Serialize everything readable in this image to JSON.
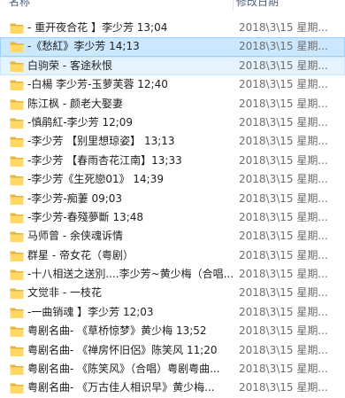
{
  "header": {
    "name_label": "名称",
    "date_label": "修改日期"
  },
  "rows": [
    {
      "name": "- 重开夜合花 】李少芳 13;04",
      "date": "2018\\3\\15 星期..."
    },
    {
      "name": "-《愁紅》李少芳 14;13",
      "date": "2018\\3\\15 星期..."
    },
    {
      "name": "白驹荣 - 客途秋恨",
      "date": "2018\\3\\15 星期..."
    },
    {
      "name": "-白楊 李少芳-玉萝芙蓉 12;40",
      "date": "2018\\3\\15 星期..."
    },
    {
      "name": "陈江枫 - 颜老大娶妻",
      "date": "2018\\3\\15 星期..."
    },
    {
      "name": "-慎鹃紅-李少芳 12;09",
      "date": "2018\\3\\15 星期..."
    },
    {
      "name": "-李少芳 【别里想琼姿】 13;13",
      "date": "2018\\3\\15 星期..."
    },
    {
      "name": "-李少芳 【春雨杏花江南】13;33",
      "date": "2018\\3\\15 星期..."
    },
    {
      "name": "-李少芳《生死戀01》 14;39",
      "date": "2018\\3\\15 星期..."
    },
    {
      "name": "-李少芳-痴萋 09;03",
      "date": "2018\\3\\15 星期..."
    },
    {
      "name": "-李少芳-春殘夢斷 13;48",
      "date": "2018\\3\\15 星期..."
    },
    {
      "name": "马师曾 - 余侠魂诉情",
      "date": "2018\\3\\15 星期..."
    },
    {
      "name": "群星 - 帝女花（粤剧）",
      "date": "2018\\3\\15 星期..."
    },
    {
      "name": "-十八相送之送別....李少芳~黄少梅（合唱...",
      "date": "2018\\3\\15 星期..."
    },
    {
      "name": "文觉非 - 一枝花",
      "date": "2018\\3\\15 星期..."
    },
    {
      "name": "-一曲销魂 】李少芳 12;03",
      "date": "2018\\3\\15 星期..."
    },
    {
      "name": "粤剧名曲- 《草桥惊梦》黄少梅 13;52",
      "date": "2018\\3\\15 星期..."
    },
    {
      "name": "粤剧名曲- 《禅房怀旧侶》陈笑风 11;20",
      "date": "2018\\3\\15 星期..."
    },
    {
      "name": "粤剧名曲- 《陈笑风》（合唱）粤剧粤曲...",
      "date": "2018\\3\\15 星期..."
    },
    {
      "name": "粤剧名曲- 《万古佳人相识早》黄少梅...",
      "date": "2018\\3\\15 星期..."
    }
  ],
  "icon": "folder-icon",
  "colors": {
    "selected_bg": "#cce8ff",
    "selected_border": "#99d1ff",
    "hover_bg": "#e5f3ff",
    "folder_body": "#ffd866",
    "folder_back": "#e8b33c"
  }
}
